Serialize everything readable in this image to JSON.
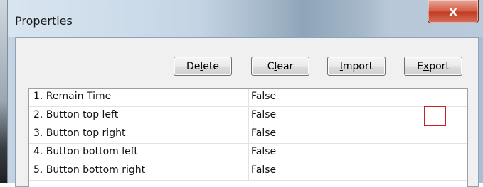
{
  "window": {
    "title": "Properties",
    "close_label": "x"
  },
  "toolbar": {
    "buttons": [
      {
        "pre": "De",
        "accel": "l",
        "post": "ete"
      },
      {
        "pre": "C",
        "accel": "l",
        "post": "ear"
      },
      {
        "pre": "",
        "accel": "I",
        "post": "mport"
      },
      {
        "pre": "E",
        "accel": "x",
        "post": "port"
      }
    ]
  },
  "grid": {
    "rows": [
      {
        "name": "1. Remain Time",
        "value": "False"
      },
      {
        "name": "2. Button top left",
        "value": "False"
      },
      {
        "name": "3. Button top right",
        "value": "False"
      },
      {
        "name": "4. Button bottom left",
        "value": "False"
      },
      {
        "name": "5. Button bottom right",
        "value": "False"
      }
    ]
  },
  "colors": {
    "highlight": "#c8202a",
    "close_button": "#c23b22"
  },
  "icons": {
    "close": "close-icon"
  }
}
